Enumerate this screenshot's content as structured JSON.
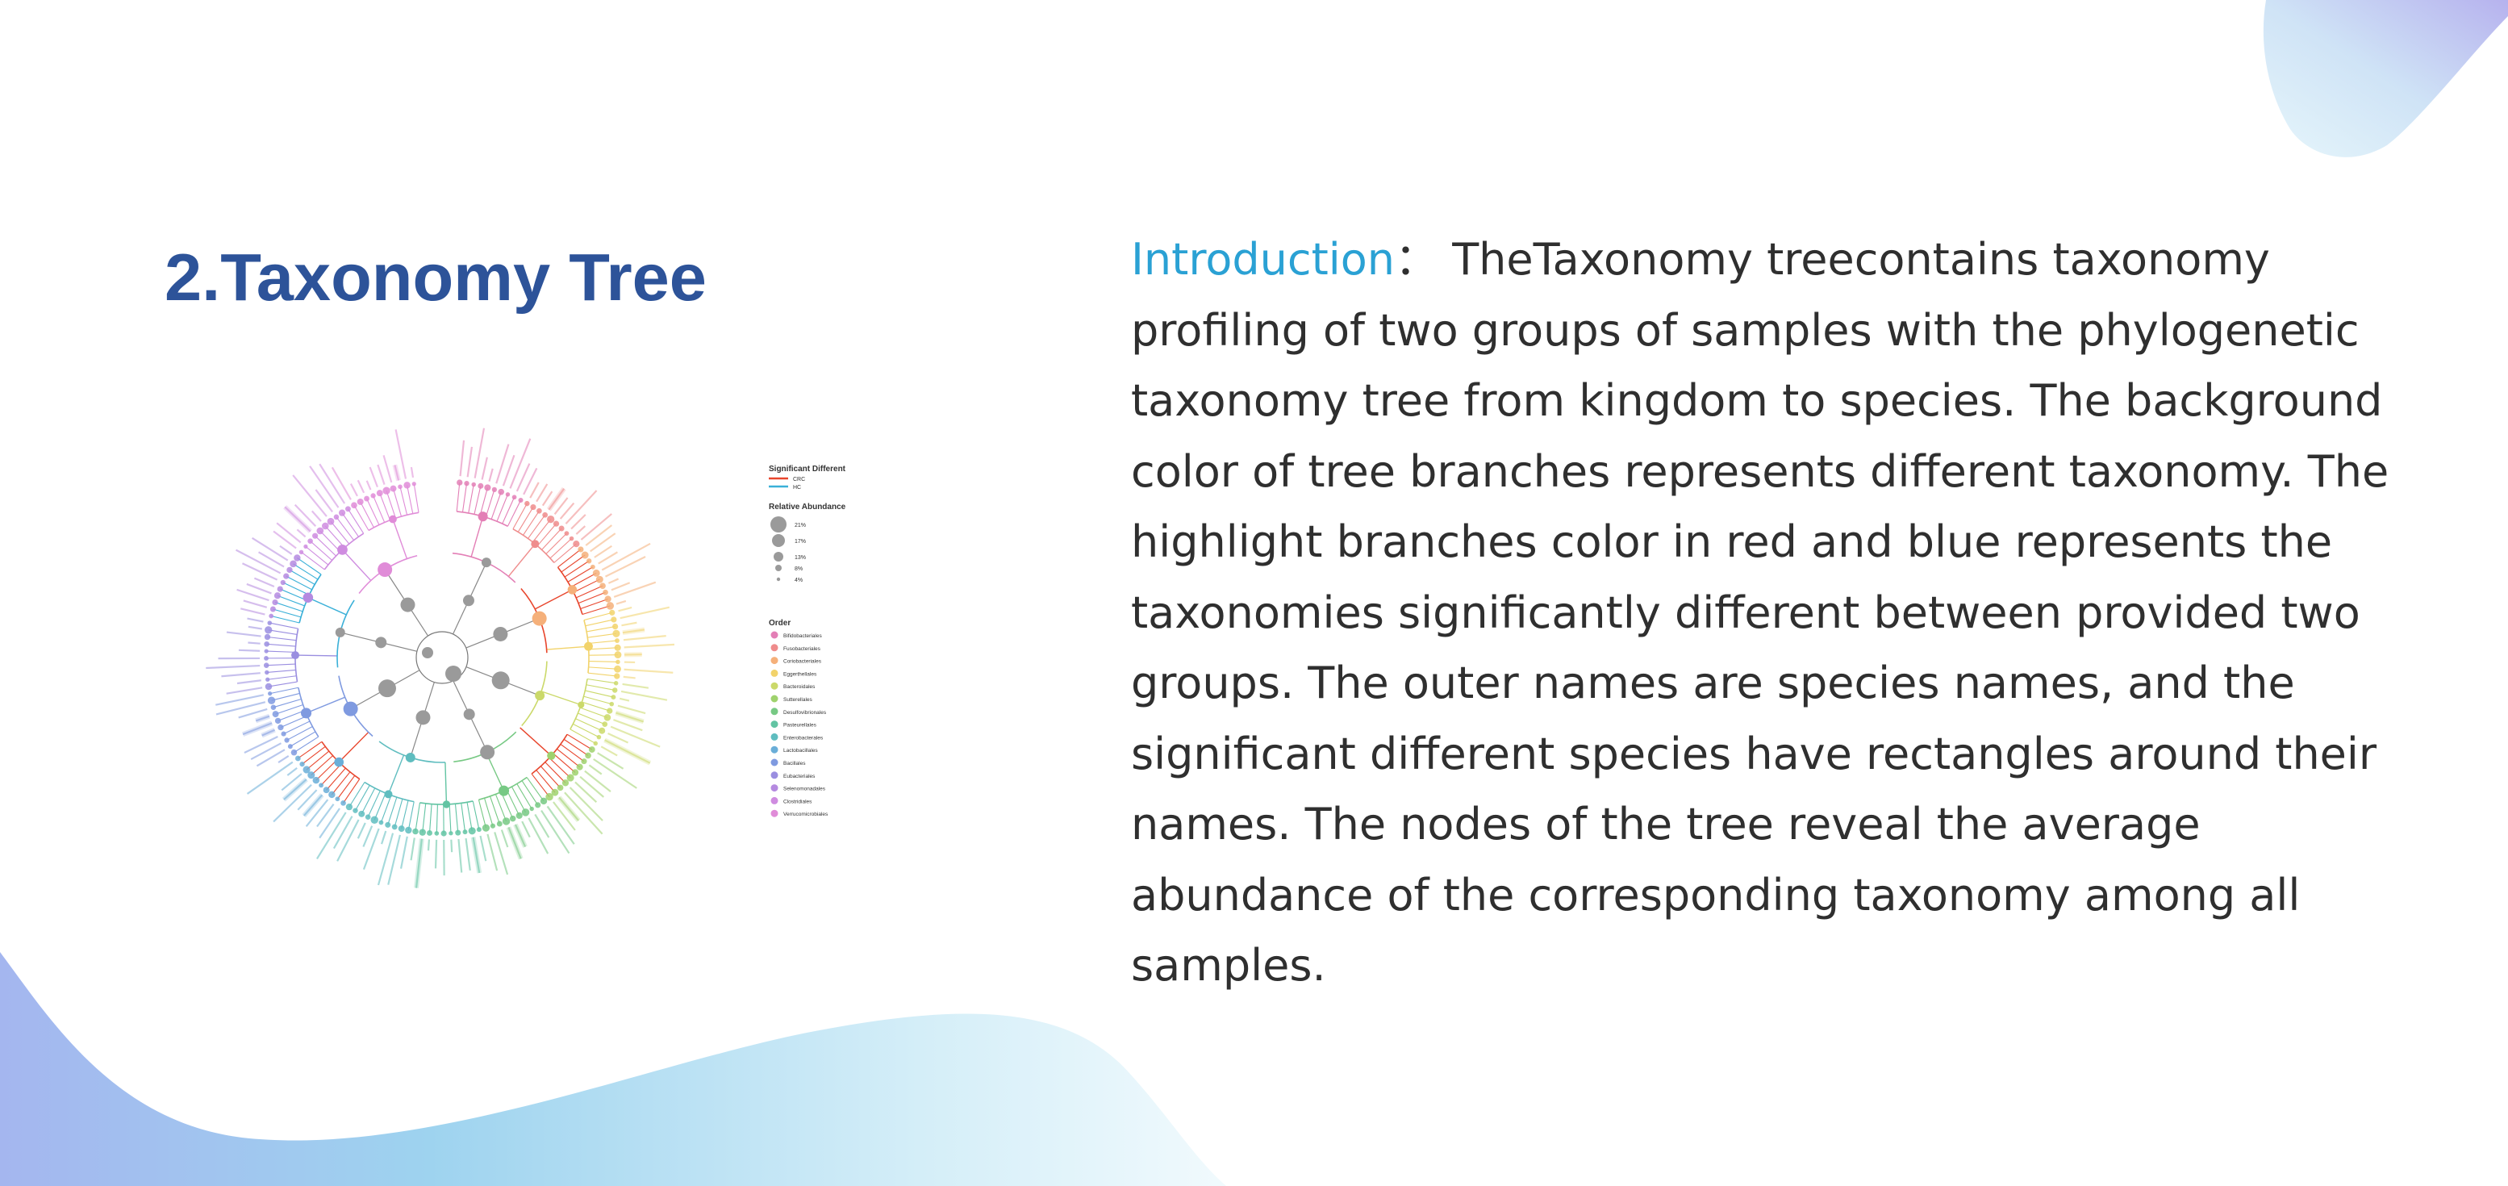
{
  "slide": {
    "title": "2.Taxonomy Tree",
    "intro_label": "Introduction",
    "intro_colon": "：",
    "intro_text": "TheTaxonomy treecontains taxonomy profiling of two groups of samples with the phylogenetic taxonomy tree from kingdom to species. The background color of tree branches represents different taxonomy. The highlight branches color in red and blue represents the taxonomies significantly different between provided two groups. The outer names are species names, and the significant different species have rectangles around their names. The nodes of the tree reveal the average abundance of the corresponding taxonomy among all samples."
  },
  "colors": {
    "title": "#2d5399",
    "intro_label": "#2aa1d4",
    "body_text": "#2f2f2f",
    "significant_red": "#e8452c",
    "significant_blue": "#3ab0d8",
    "node_gray": "#9a9a9a"
  },
  "figure": {
    "legend": {
      "significant_title": "Significant Different",
      "significant_items": [
        {
          "label": "CRC",
          "color": "#e8452c"
        },
        {
          "label": "HC",
          "color": "#3ab0d8"
        }
      ],
      "abundance_title": "Relative Abundance",
      "abundance_items": [
        "21%",
        "17%",
        "13%",
        "8%",
        "4%"
      ],
      "order_title": "Order",
      "order_items": [
        {
          "label": "Bifidobacteriales",
          "color": "#e37fb6"
        },
        {
          "label": "Fusobacteriales",
          "color": "#ef8c8c"
        },
        {
          "label": "Coriobacteriales",
          "color": "#f5b07a"
        },
        {
          "label": "Eggerthellales",
          "color": "#f2d36b"
        },
        {
          "label": "Bacteroidales",
          "color": "#cbd96a"
        },
        {
          "label": "Sutterellales",
          "color": "#9fd26d"
        },
        {
          "label": "Desulfovibrionales",
          "color": "#77c984"
        },
        {
          "label": "Pasteurellales",
          "color": "#62c4a3"
        },
        {
          "label": "Enterobacterales",
          "color": "#5fbdbf"
        },
        {
          "label": "Lactobacillales",
          "color": "#6aaed8"
        },
        {
          "label": "Bacillales",
          "color": "#7f9ae0"
        },
        {
          "label": "Eubacteriales",
          "color": "#9a8ee0"
        },
        {
          "label": "Selenomonadales",
          "color": "#b58ae0"
        },
        {
          "label": "Clostridiales",
          "color": "#cf8ce0"
        },
        {
          "label": "Verrucomicrobiales",
          "color": "#e08cd8"
        }
      ]
    }
  }
}
